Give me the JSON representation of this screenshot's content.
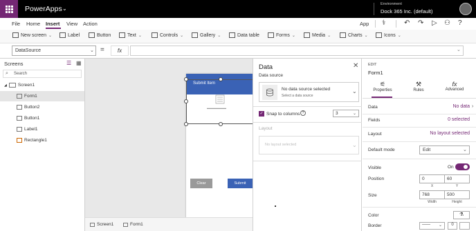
{
  "titlebar": {
    "app_name": "PowerApps",
    "environment_label": "Environment",
    "environment_value": "Dock 365 Inc. (default)"
  },
  "menu": {
    "items": [
      "File",
      "Home",
      "Insert",
      "View",
      "Action"
    ],
    "active": "Insert",
    "app_label": "App"
  },
  "ribbon": {
    "items": [
      "New screen",
      "Label",
      "Button",
      "Text",
      "Controls",
      "Gallery",
      "Data table",
      "Forms",
      "Media",
      "Charts",
      "Icons"
    ]
  },
  "formula": {
    "property": "DataSource",
    "fx_label": "fx",
    "value": ""
  },
  "screens_panel": {
    "title": "Screens",
    "search_placeholder": "Search",
    "tree": [
      "Screen1",
      "Form1",
      "Button2",
      "Button1",
      "Label1",
      "Rectangle1"
    ]
  },
  "canvas": {
    "header_text": "Submit Item",
    "clear_label": "Clear",
    "submit_label": "Submit",
    "tabs": [
      "Screen1",
      "Form1"
    ]
  },
  "data_panel": {
    "title": "Data",
    "data_source_label": "Data source",
    "no_source_title": "No data source selected",
    "no_source_subtitle": "Select a data source",
    "snap_label": "Snap to columns",
    "snap_checked": true,
    "columns_value": "3",
    "layout_label": "Layout",
    "layout_placeholder": "No layout selected"
  },
  "props_panel": {
    "edit_label": "EDIT",
    "control_name": "Form1",
    "tabs": [
      "Properties",
      "Rules",
      "Advanced"
    ],
    "data_label": "Data",
    "data_value": "No data",
    "fields_label": "Fields",
    "fields_value": "0 selected",
    "layout_label": "Layout",
    "layout_value": "No layout selected",
    "default_mode_label": "Default mode",
    "default_mode_value": "Edit",
    "visible_label": "Visible",
    "visible_value": "On",
    "position_label": "Position",
    "position_x": "0",
    "position_y": "60",
    "x_caption": "X",
    "y_caption": "Y",
    "size_label": "Size",
    "size_width": "768",
    "size_height": "500",
    "width_caption": "Width",
    "height_caption": "Height",
    "color_label": "Color",
    "border_label": "Border",
    "border_width": "0"
  },
  "colors": {
    "brand": "#742774",
    "header_blue": "#3a62b5",
    "titlebar": "#000000"
  }
}
